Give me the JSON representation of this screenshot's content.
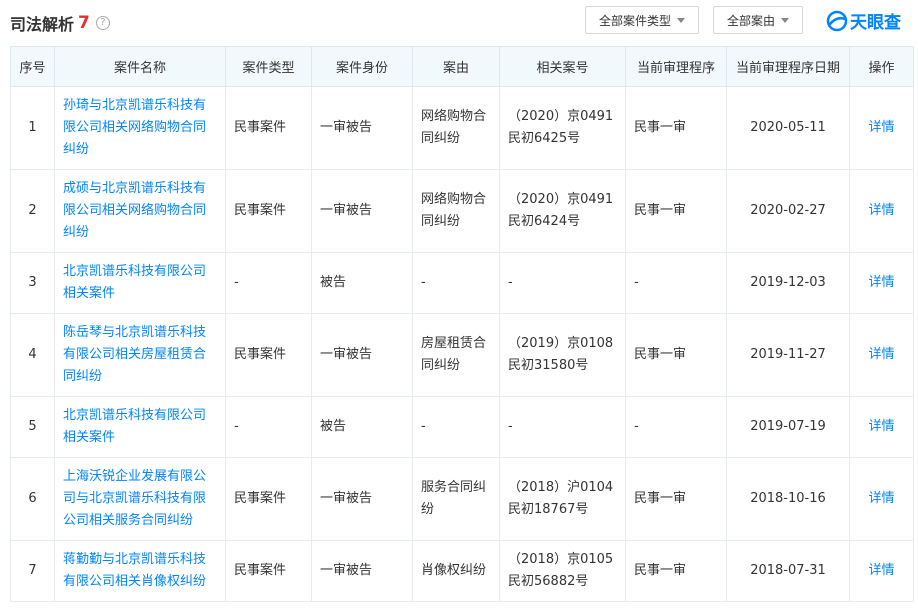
{
  "header": {
    "title": "司法解析",
    "count": "7",
    "help_icon_glyph": "?",
    "filter_type_label": "全部案件类型",
    "filter_cause_label": "全部案由",
    "logo_text": "天眼查",
    "logo_icon": "tianyancha-logo-icon"
  },
  "colors": {
    "accent": "#0084ff",
    "count_red": "#e62e2e",
    "header_bg": "#f2f9fc"
  },
  "table": {
    "columns": [
      "序号",
      "案件名称",
      "案件类型",
      "案件身份",
      "案由",
      "相关案号",
      "当前审理程序",
      "当前审理程序日期",
      "操作"
    ],
    "rows": [
      {
        "index": "1",
        "name": "孙琦与北京凯谱乐科技有限公司相关网络购物合同纠纷",
        "type": "民事案件",
        "identity": "一审被告",
        "cause": "网络购物合同纠纷",
        "case_no": "（2020）京0491民初6425号",
        "procedure": "民事一审",
        "date": "2020-05-11",
        "action": "详情"
      },
      {
        "index": "2",
        "name": "成硕与北京凯谱乐科技有限公司相关网络购物合同纠纷",
        "type": "民事案件",
        "identity": "一审被告",
        "cause": "网络购物合同纠纷",
        "case_no": "（2020）京0491民初6424号",
        "procedure": "民事一审",
        "date": "2020-02-27",
        "action": "详情"
      },
      {
        "index": "3",
        "name": "北京凯谱乐科技有限公司相关案件",
        "type": "-",
        "identity": "被告",
        "cause": "-",
        "case_no": "-",
        "procedure": "-",
        "date": "2019-12-03",
        "action": "详情"
      },
      {
        "index": "4",
        "name": "陈岳琴与北京凯谱乐科技有限公司相关房屋租赁合同纠纷",
        "type": "民事案件",
        "identity": "一审被告",
        "cause": "房屋租赁合同纠纷",
        "case_no": "（2019）京0108民初31580号",
        "procedure": "民事一审",
        "date": "2019-11-27",
        "action": "详情"
      },
      {
        "index": "5",
        "name": "北京凯谱乐科技有限公司相关案件",
        "type": "-",
        "identity": "被告",
        "cause": "-",
        "case_no": "-",
        "procedure": "-",
        "date": "2019-07-19",
        "action": "详情"
      },
      {
        "index": "6",
        "name": "上海沃锐企业发展有限公司与北京凯谱乐科技有限公司相关服务合同纠纷",
        "type": "民事案件",
        "identity": "一审被告",
        "cause": "服务合同纠纷",
        "case_no": "（2018）沪0104民初18767号",
        "procedure": "民事一审",
        "date": "2018-10-16",
        "action": "详情"
      },
      {
        "index": "7",
        "name": "蒋勤勤与北京凯谱乐科技有限公司相关肖像权纠纷",
        "type": "民事案件",
        "identity": "一审被告",
        "cause": "肖像权纠纷",
        "case_no": "（2018）京0105民初56882号",
        "procedure": "民事一审",
        "date": "2018-07-31",
        "action": "详情"
      }
    ]
  }
}
